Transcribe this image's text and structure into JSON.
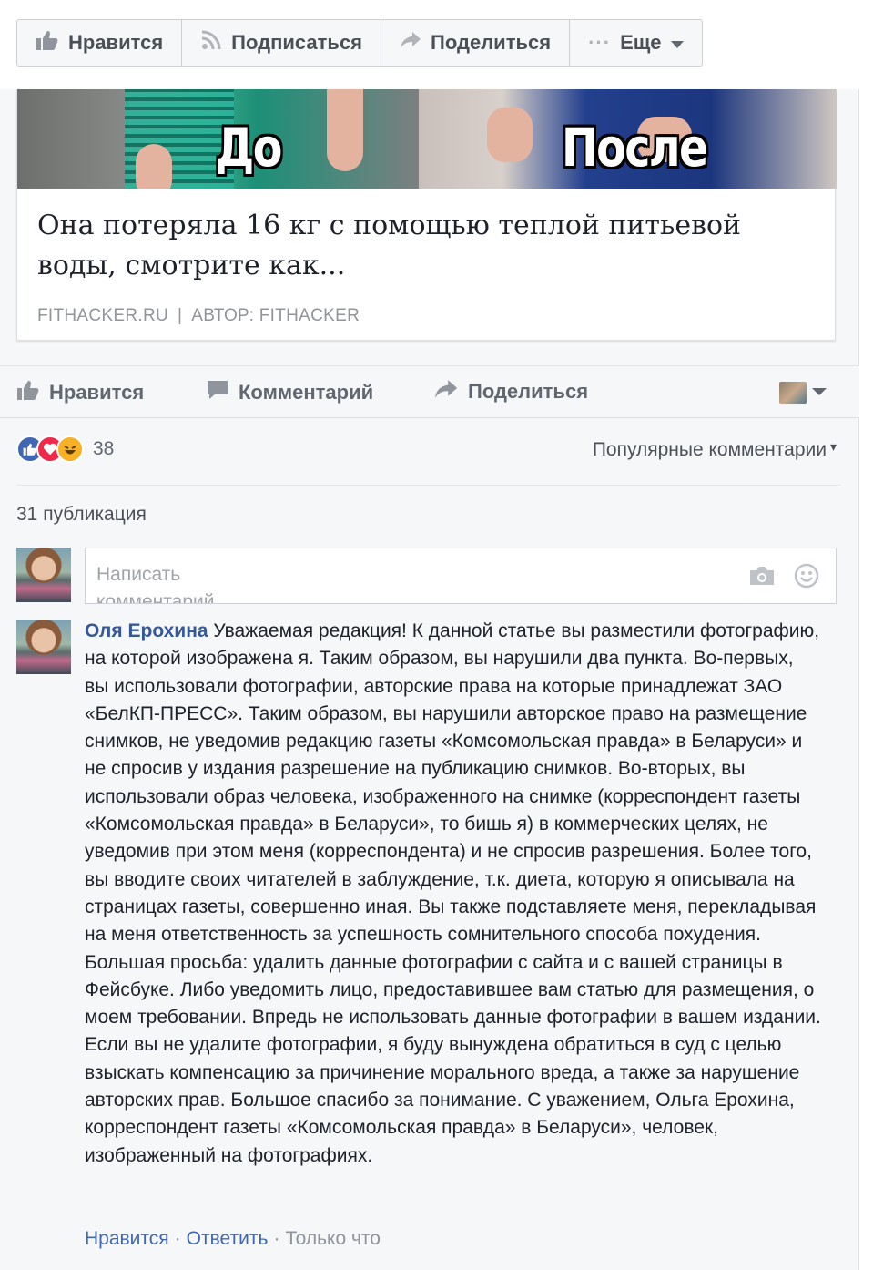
{
  "page_actions": {
    "like": "Нравится",
    "follow": "Подписаться",
    "share": "Поделиться",
    "more": "Еще"
  },
  "link_card": {
    "image_left_label": "До",
    "image_right_label": "После",
    "title": "Она потеряла 16 кг с помощью теплой питьевой воды, смотрите как...",
    "domain": "FITHACKER.RU",
    "author": "АВТОР: FITHACKER"
  },
  "post_actions": {
    "like": "Нравится",
    "comment": "Комментарий",
    "share": "Поделиться"
  },
  "reactions": {
    "count": "38",
    "sort_label": "Популярные комментарии"
  },
  "shares": {
    "label": "31 публикация"
  },
  "comment_input": {
    "placeholder": "Написать комментарий"
  },
  "comment": {
    "author": "Оля Ерохина",
    "text": "Уважаемая редакция! К данной статье вы разместили фотографию, на которой изображена я. Таким образом, вы нарушили два пункта. Во-первых, вы использовали фотографии, авторские права на которые принадлежат ЗАО «БелКП-ПРЕСС». Таким образом, вы нарушили авторское право на размещение снимков, не уведомив редакцию газеты «Комсомольская правда» в Беларуси» и не спросив у издания разрешение на публикацию снимков. Во-вторых, вы использовали образ человека, изображенного на снимке (корреспондент газеты «Комсомольская правда» в Беларуси», то бишь я) в коммерческих целях, не уведомив при этом меня (корреспондента) и не спросив разрешения. Более того, вы вводите своих читателей в заблуждение, т.к. диета, которую я описывала на страницах газеты, совершенно иная. Вы также подставляете меня, перекладывая на меня ответственность за успешность сомнительного способа похудения. Большая просьба: удалить данные фотографии с сайта и с вашей страницы в Фейсбуке. Либо уведомить лицо, предоставившее вам статью для размещения, о моем требовании. Впредь не использовать данные фотографии в вашем издании. Если вы не удалите фотографии, я буду вынуждена обратиться в суд с целью взыскать компенсацию за причинение морального вреда, а также за нарушение авторских прав. Большое спасибо за понимание. С уважением, Ольга Ерохина, корреспондент газеты «Комсомольская правда» в Беларуси», человек, изображенный на фотографиях.",
    "like": "Нравится",
    "reply": "Ответить",
    "time": "Только что"
  },
  "colors": {
    "link_blue": "#4267b2",
    "author_blue": "#365899",
    "feed_bg": "#f6f7f9",
    "muted_text": "#90949c"
  },
  "icons": [
    "thumbs-up-icon",
    "rss-icon",
    "share-arrow-icon",
    "ellipsis-icon",
    "caret-down-icon",
    "comment-bubble-icon",
    "camera-icon",
    "smiley-icon",
    "like-reaction-icon",
    "love-reaction-icon",
    "haha-reaction-icon"
  ]
}
